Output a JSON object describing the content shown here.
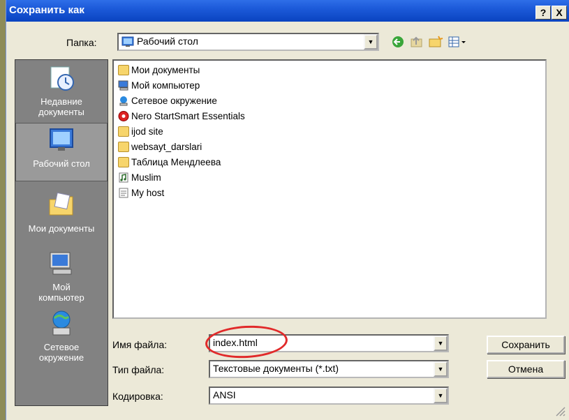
{
  "window": {
    "title": "Сохранить как",
    "help_btn": "?",
    "close_btn": "X"
  },
  "toolbar": {
    "folder_label": "Папка:",
    "folder_value": "Рабочий стол"
  },
  "places": [
    {
      "label": "Недавние документы",
      "icon": "recent-documents-icon"
    },
    {
      "label": "Рабочий стол",
      "icon": "desktop-icon"
    },
    {
      "label": "Мои документы",
      "icon": "my-documents-icon"
    },
    {
      "label": "Мой компьютер",
      "icon": "my-computer-icon"
    },
    {
      "label": "Сетевое окружение",
      "icon": "network-icon"
    }
  ],
  "files": [
    {
      "name": "Мои документы",
      "icon": "folder-docs-icon"
    },
    {
      "name": "Мой компьютер",
      "icon": "computer-icon"
    },
    {
      "name": "Сетевое окружение",
      "icon": "network-icon"
    },
    {
      "name": "Nero StartSmart Essentials",
      "icon": "nero-icon"
    },
    {
      "name": "ijod site",
      "icon": "folder-icon"
    },
    {
      "name": "websayt_darslari",
      "icon": "folder-icon"
    },
    {
      "name": "Таблица Мендлеева",
      "icon": "folder-icon"
    },
    {
      "name": "Muslim",
      "icon": "music-file-icon"
    },
    {
      "name": "My host",
      "icon": "text-file-icon"
    }
  ],
  "form": {
    "filename_label": "Имя файла:",
    "filename_value": "index.html",
    "filetype_label": "Тип файла:",
    "filetype_value": "Текстовые документы (*.txt)",
    "encoding_label": "Кодировка:",
    "encoding_value": "ANSI",
    "save_button": "Сохранить",
    "cancel_button": "Отмена"
  }
}
